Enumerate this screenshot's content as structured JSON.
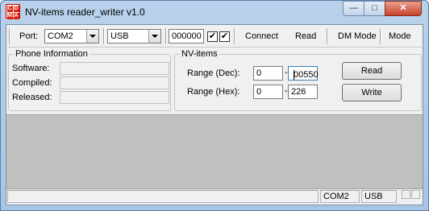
{
  "window": {
    "title": "NV-items reader_writer v1.0",
    "icon_letters": [
      "C",
      "D",
      "M",
      "A"
    ],
    "minimize_glyph": "—",
    "maximize_glyph": "□",
    "close_glyph": "✕"
  },
  "toolbar": {
    "port_label": "Port:",
    "port_value": "COM2",
    "mode_value": "USB",
    "code_value": "000000",
    "check1": "✔",
    "check2": "✔",
    "connect_label": "Connect",
    "read_label": "Read",
    "dm_mode_label": "DM Mode",
    "mode_label": "Mode"
  },
  "phone_info": {
    "title": "Phone Information",
    "software_label": "Software:",
    "compiled_label": "Compiled:",
    "released_label": "Released:"
  },
  "nv_items": {
    "title": "NV-items",
    "range_dec_label": "Range (Dec):",
    "range_dec_from": "0",
    "range_dec_to": "00550",
    "range_hex_label": "Range (Hex):",
    "range_hex_from": "0",
    "range_hex_to": "226",
    "dash": "-",
    "read_button": "Read",
    "write_button": "Write"
  },
  "status": {
    "port": "COM2",
    "mode": "USB"
  }
}
